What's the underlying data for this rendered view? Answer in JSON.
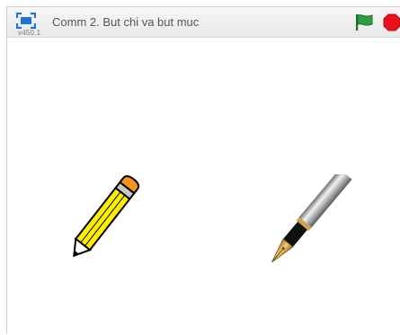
{
  "player": {
    "title": "Comm 2. But chi va but muc",
    "version": "v450.1"
  },
  "controls": {
    "fullscreen_icon": "fullscreen-icon",
    "green_flag_icon": "green-flag-icon",
    "stop_icon": "stop-sign-icon"
  },
  "colors": {
    "accent_blue": "#1b74d6",
    "flag_green": "#2e9e3e",
    "stop_red": "#e8101d"
  },
  "stage": {
    "sprites": [
      "pencil",
      "fountain-pen"
    ]
  }
}
